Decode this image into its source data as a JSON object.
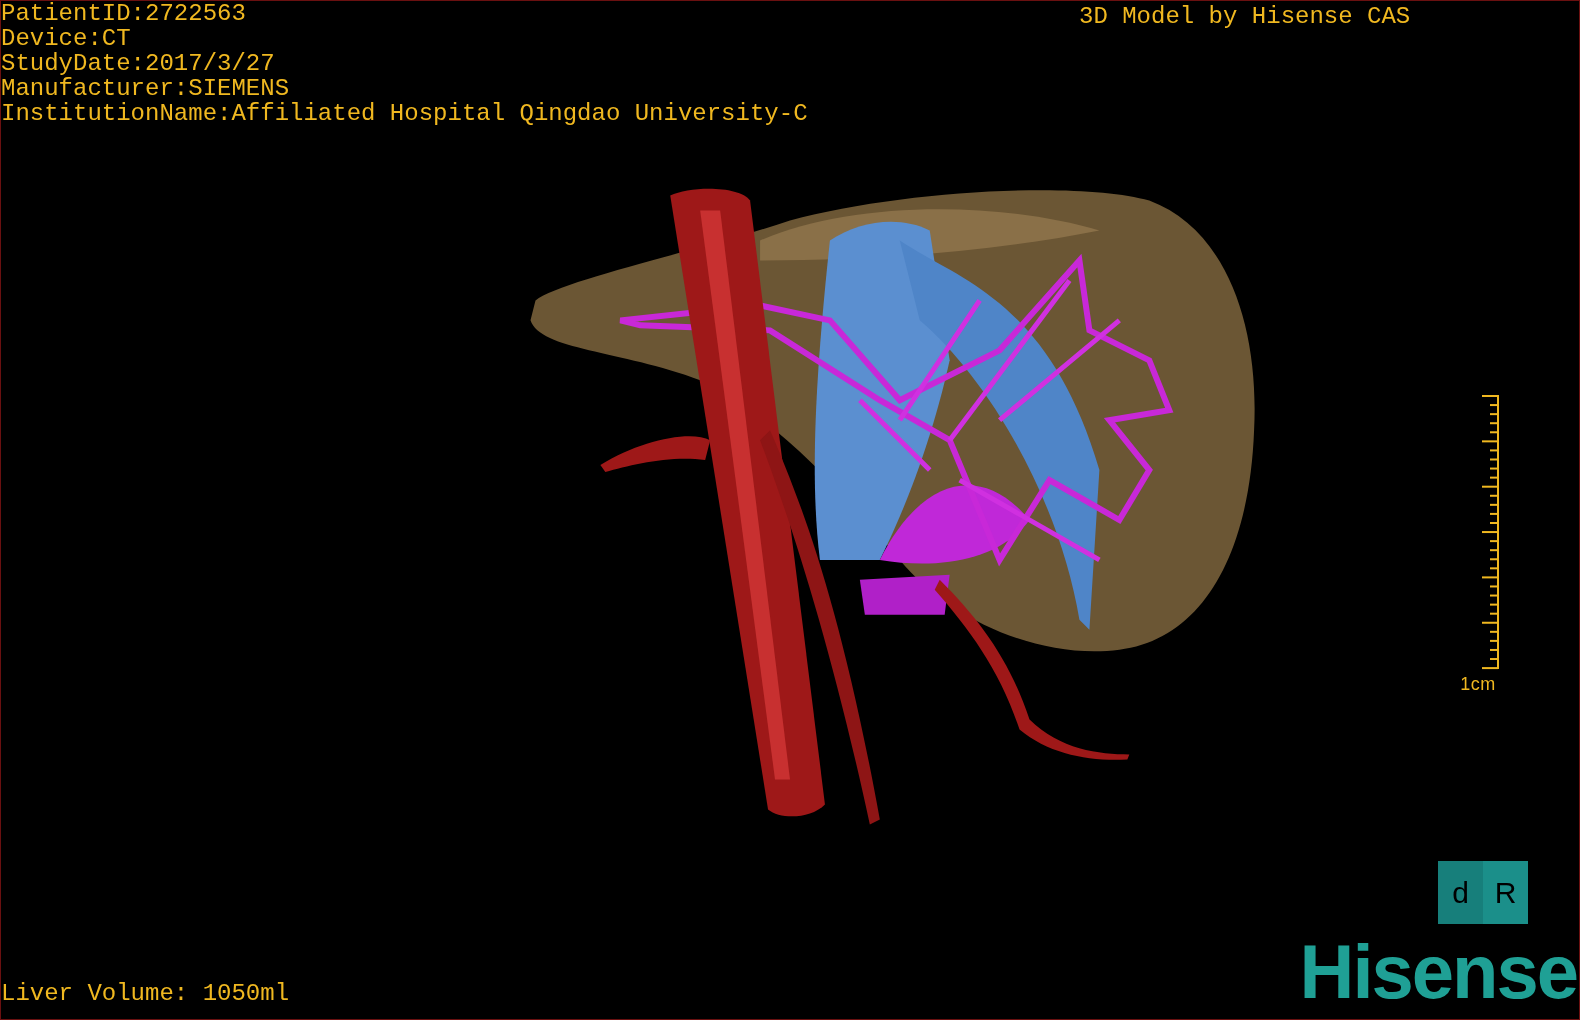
{
  "patient_info": [
    "PatientID:2722563",
    "Device:CT",
    "StudyDate:2017/3/27",
    "Manufacturer:SIEMENS",
    "InstitutionName:Affiliated Hospital Qingdao University-C"
  ],
  "model_credit": "3D Model by Hisense CAS",
  "scale_bar": {
    "label": "1cm"
  },
  "orientation_cube": {
    "faces": [
      "d",
      "R"
    ]
  },
  "liver_volume": "Liver Volume: 1050ml",
  "logo": {
    "text": "Hisense"
  }
}
